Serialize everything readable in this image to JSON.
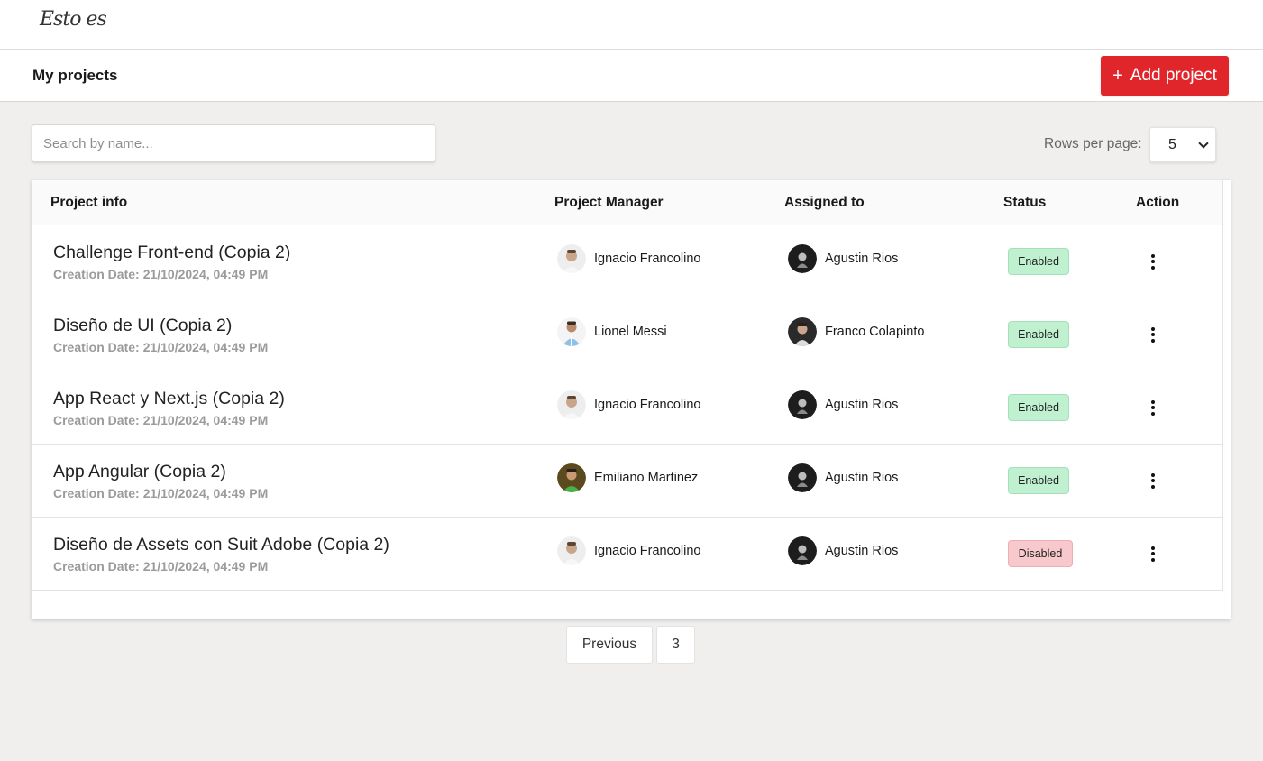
{
  "header": {
    "logo_text": "Esto es"
  },
  "toolbar": {
    "title": "My projects",
    "add_label": "Add project",
    "add_icon": "plus-icon",
    "accent": "#e0262b"
  },
  "filters": {
    "search_placeholder": "Search by name...",
    "rows_label": "Rows per page:",
    "rows_value": "5"
  },
  "table": {
    "columns": [
      "Project info",
      "Project Manager",
      "Assigned to",
      "Status",
      "Action"
    ],
    "date_label": "Creation Date:",
    "rows": [
      {
        "name": "Challenge Front-end (Copia 2)",
        "date": "21/10/2024, 04:49 PM",
        "manager": "Ignacio Francolino",
        "assigned": "Agustin Rios",
        "status": "Enabled"
      },
      {
        "name": "Diseño de UI (Copia 2)",
        "date": "21/10/2024, 04:49 PM",
        "manager": "Lionel Messi",
        "assigned": "Franco Colapinto",
        "status": "Enabled"
      },
      {
        "name": "App React y Next.js (Copia 2)",
        "date": "21/10/2024, 04:49 PM",
        "manager": "Ignacio Francolino",
        "assigned": "Agustin Rios",
        "status": "Enabled"
      },
      {
        "name": "App Angular (Copia 2)",
        "date": "21/10/2024, 04:49 PM",
        "manager": "Emiliano Martinez",
        "assigned": "Agustin Rios",
        "status": "Enabled"
      },
      {
        "name": "Diseño de Assets con Suit Adobe (Copia 2)",
        "date": "21/10/2024, 04:49 PM",
        "manager": "Ignacio Francolino",
        "assigned": "Agustin Rios",
        "status": "Disabled"
      }
    ]
  },
  "pagination": {
    "previous_label": "Previous",
    "current_page": "3"
  },
  "colors": {
    "enabled": "#bff0cf",
    "disabled": "#f8c9cc"
  }
}
